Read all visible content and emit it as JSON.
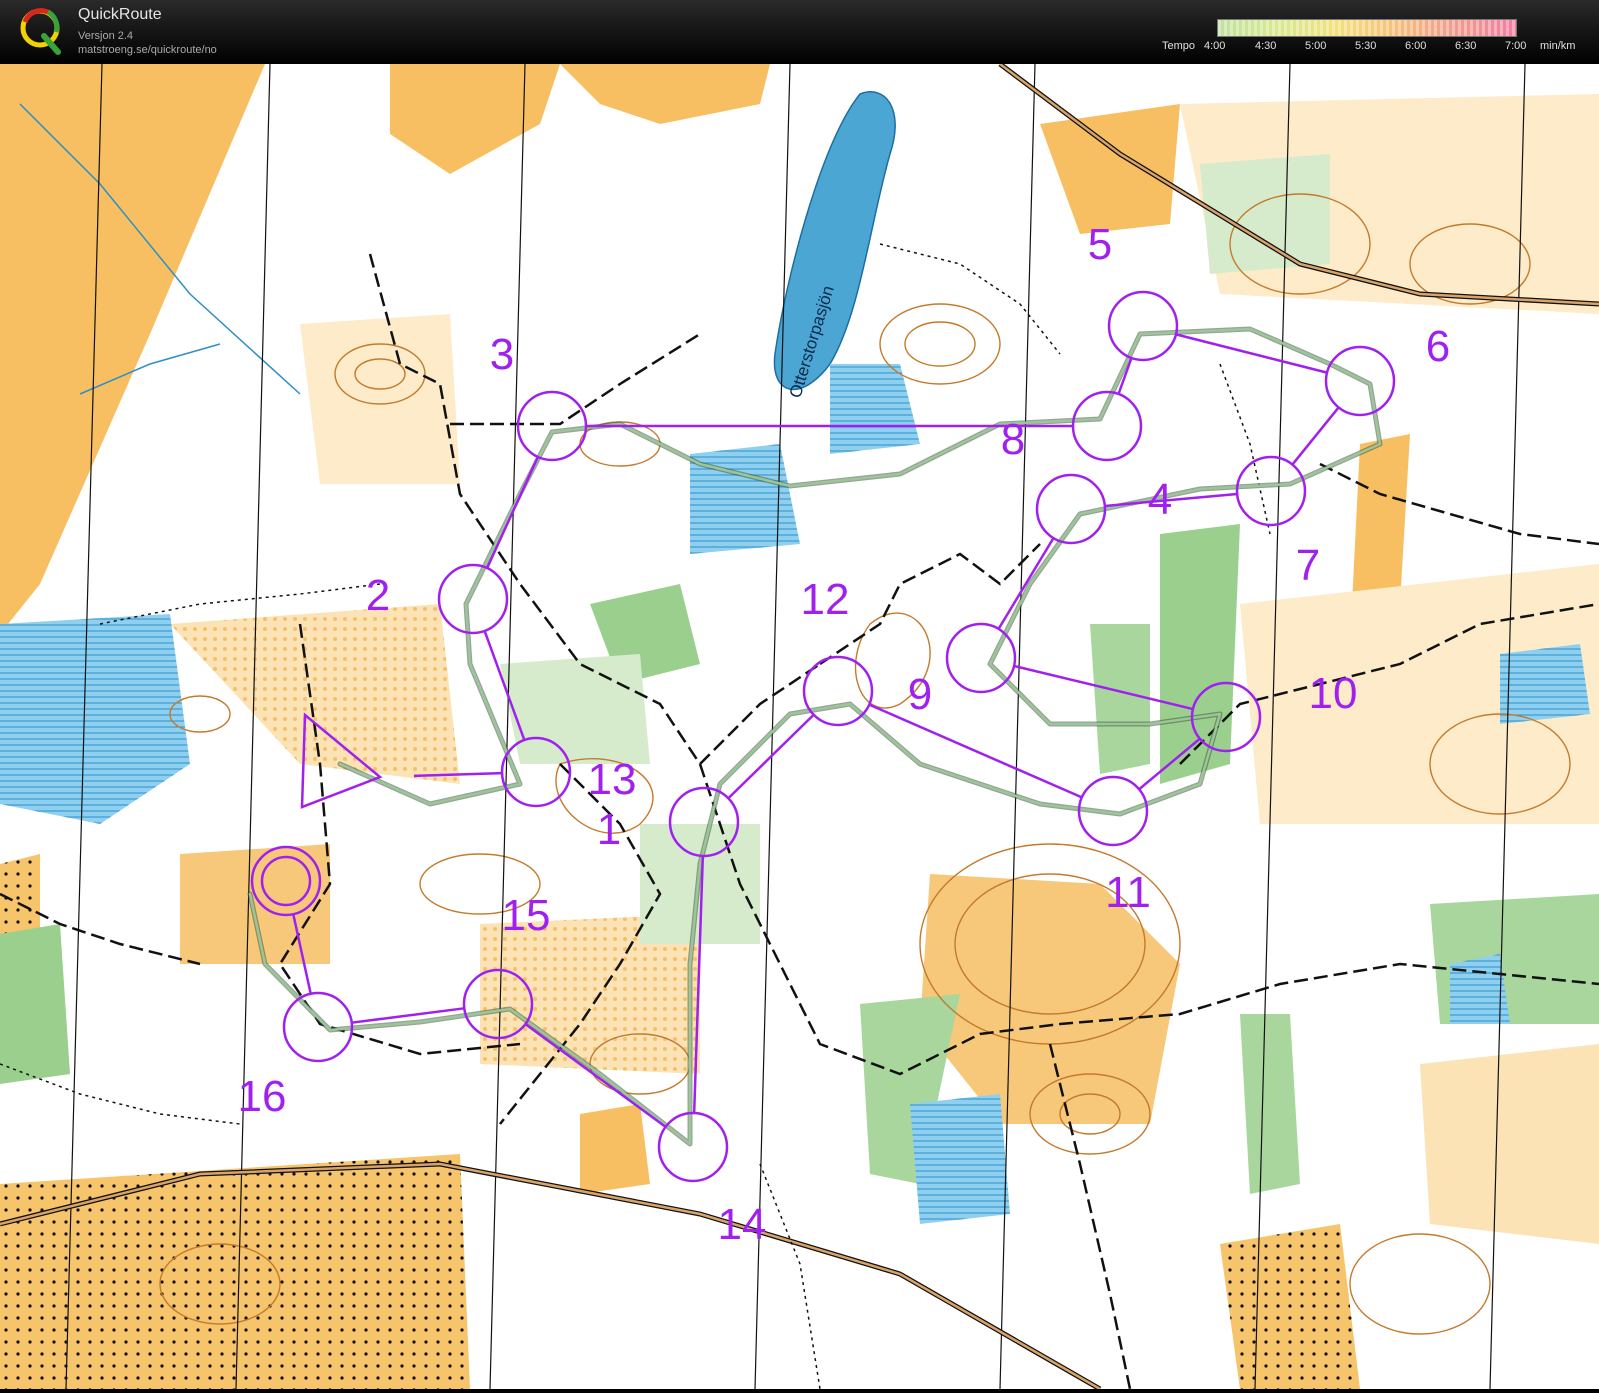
{
  "app": {
    "name": "QuickRoute",
    "version": "Versjon 2.4",
    "url": "matstroeng.se/quickroute/no"
  },
  "pace_legend": {
    "label": "Tempo",
    "ticks": [
      "4:00",
      "4:30",
      "5:00",
      "5:30",
      "6:00",
      "6:30",
      "7:00"
    ],
    "unit": "min/km"
  },
  "map": {
    "lake_name": "Otterstorpasjön",
    "course_color": "#a020f0",
    "controls": [
      {
        "id": "start"
      },
      {
        "id": "1",
        "label": "1"
      },
      {
        "id": "2",
        "label": "2"
      },
      {
        "id": "3",
        "label": "3"
      },
      {
        "id": "4",
        "label": "4"
      },
      {
        "id": "5",
        "label": "5"
      },
      {
        "id": "6",
        "label": "6"
      },
      {
        "id": "7",
        "label": "7"
      },
      {
        "id": "8",
        "label": "8"
      },
      {
        "id": "9",
        "label": "9"
      },
      {
        "id": "10",
        "label": "10"
      },
      {
        "id": "11",
        "label": "11"
      },
      {
        "id": "12",
        "label": "12"
      },
      {
        "id": "13",
        "label": "13"
      },
      {
        "id": "14",
        "label": "14"
      },
      {
        "id": "15",
        "label": "15"
      },
      {
        "id": "16",
        "label": "16"
      },
      {
        "id": "finish"
      }
    ]
  }
}
